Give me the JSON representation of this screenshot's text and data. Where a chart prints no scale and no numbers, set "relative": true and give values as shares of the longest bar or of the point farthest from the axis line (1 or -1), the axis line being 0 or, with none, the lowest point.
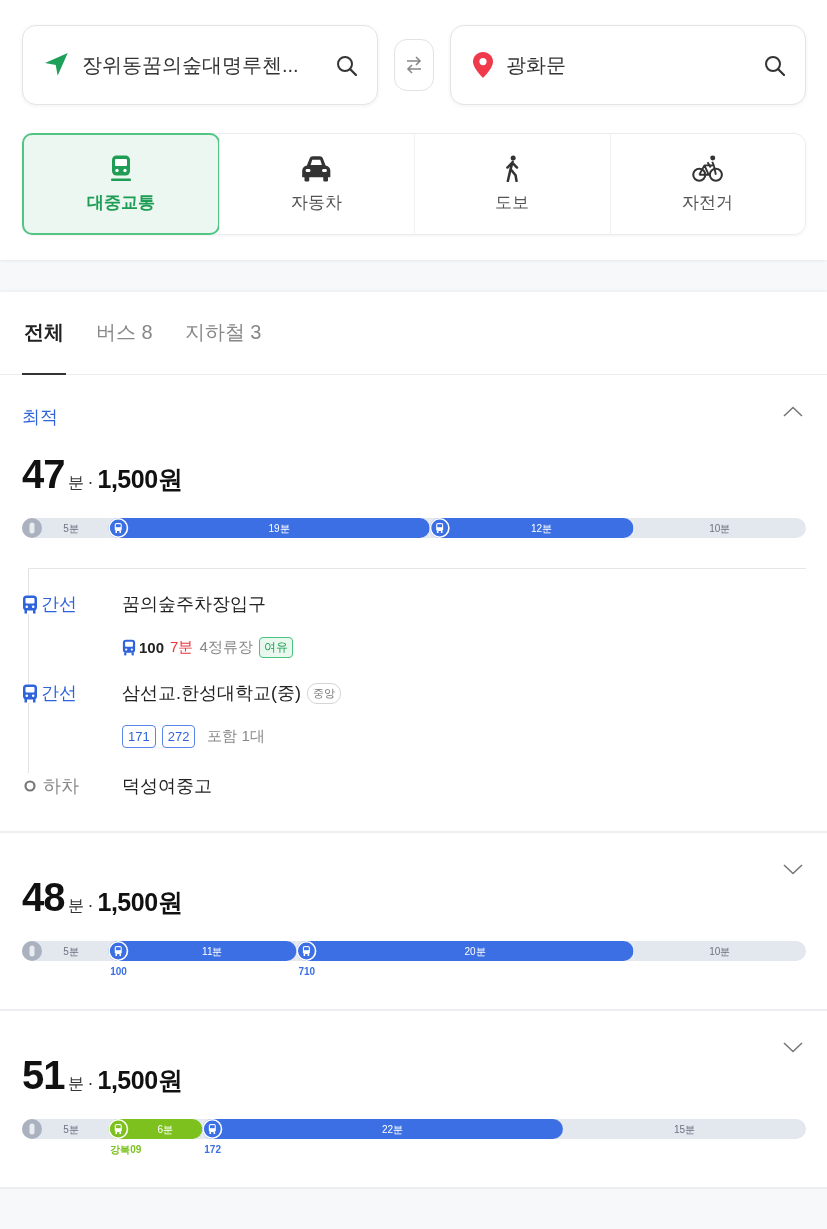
{
  "origin": {
    "value": "장위동꿈의숲대명루첸..."
  },
  "destination": {
    "value": "광화문"
  },
  "modes": [
    {
      "kind": "transit",
      "label": "대중교통",
      "selected": true
    },
    {
      "kind": "car",
      "label": "자동차",
      "selected": false
    },
    {
      "kind": "walk",
      "label": "도보",
      "selected": false
    },
    {
      "kind": "bike",
      "label": "자전거",
      "selected": false
    }
  ],
  "filter_tabs": [
    {
      "label": "전체",
      "selected": true
    },
    {
      "label": "버스 8",
      "selected": false
    },
    {
      "label": "지하철 3",
      "selected": false
    }
  ],
  "routes": [
    {
      "tag": "최적",
      "expanded": true,
      "duration": "47",
      "duration_unit": "분",
      "separator": "·",
      "fare": "1,500원",
      "legs": [
        {
          "kind": "walk"
        },
        {
          "kind": "bus"
        },
        {
          "kind": "bus"
        },
        {
          "kind": "walk"
        }
      ],
      "chart_data": {
        "type": "bar",
        "orientation": "horizontal",
        "stacked": true,
        "relative": true,
        "categories": [
          null
        ],
        "series": [
          {
            "color": "#e3e7ee",
            "values": [
              0.11
            ]
          },
          {
            "color": "#3b6fe3",
            "values": [
              0.41
            ]
          },
          {
            "color": "#3b6fe3",
            "values": [
              0.26
            ]
          },
          {
            "color": "#e3e7ee",
            "values": [
              0.22
            ]
          }
        ],
        "value_labels": [
          "5분",
          "19분",
          "12분",
          "10분"
        ]
      },
      "steps": [
        {
          "kind": "bus",
          "type": "간선",
          "stop": "꿈의숲주차장입구",
          "detail": {
            "kind": "arrival",
            "bus": "100",
            "eta": "7분",
            "stops": "4정류장",
            "crowd": "여유"
          }
        },
        {
          "kind": "bus",
          "type": "간선",
          "stop": "삼선교.한성대학교(중)",
          "stop_badge": "중앙",
          "detail": {
            "kind": "routes",
            "routes": [
              "171",
              "272"
            ],
            "note": "포함 1대"
          }
        },
        {
          "kind": "alight",
          "type": "하차",
          "stop": "덕성여중고"
        }
      ]
    },
    {
      "expanded": false,
      "duration": "48",
      "duration_unit": "분",
      "separator": "·",
      "fare": "1,500원",
      "legs": [
        {
          "kind": "walk"
        },
        {
          "kind": "bus",
          "route": "100"
        },
        {
          "kind": "bus",
          "route": "710"
        },
        {
          "kind": "walk"
        }
      ],
      "chart_data": {
        "type": "bar",
        "orientation": "horizontal",
        "stacked": true,
        "relative": true,
        "categories": [
          null
        ],
        "series": [
          {
            "color": "#e3e7ee",
            "values": [
              0.11
            ]
          },
          {
            "color": "#3b6fe3",
            "values": [
              0.24
            ]
          },
          {
            "color": "#3b6fe3",
            "values": [
              0.43
            ]
          },
          {
            "color": "#e3e7ee",
            "values": [
              0.22
            ]
          }
        ],
        "value_labels": [
          "5분",
          "11분",
          "20분",
          "10분"
        ]
      }
    },
    {
      "expanded": false,
      "duration": "51",
      "duration_unit": "분",
      "separator": "·",
      "fare": "1,500원",
      "legs": [
        {
          "kind": "walk"
        },
        {
          "kind": "bus",
          "route": "강북09"
        },
        {
          "kind": "bus",
          "route": "172"
        },
        {
          "kind": "walk"
        }
      ],
      "chart_data": {
        "type": "bar",
        "orientation": "horizontal",
        "stacked": true,
        "relative": true,
        "categories": [
          null
        ],
        "series": [
          {
            "color": "#e3e7ee",
            "values": [
              0.11
            ]
          },
          {
            "color": "#7cc11e",
            "values": [
              0.12
            ]
          },
          {
            "color": "#3b6fe3",
            "values": [
              0.46
            ]
          },
          {
            "color": "#e3e7ee",
            "values": [
              0.31
            ]
          }
        ],
        "value_labels": [
          "5분",
          "6분",
          "22분",
          "15분"
        ]
      }
    }
  ]
}
